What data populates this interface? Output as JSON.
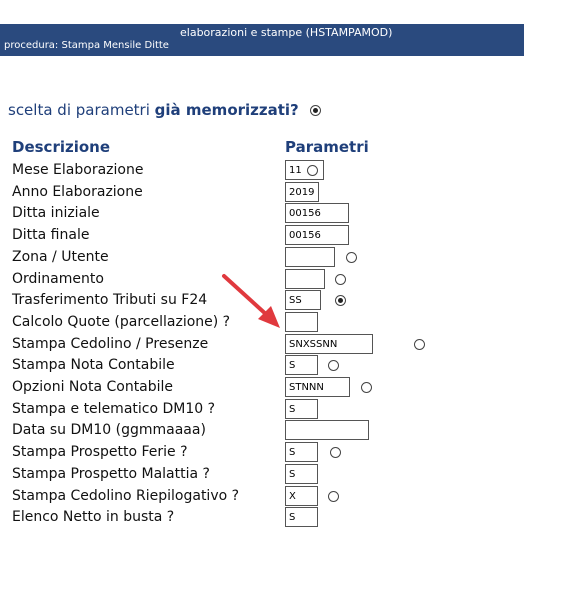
{
  "banner": {
    "line1": "elaborazioni e stampe    (HSTAMPAMOD)",
    "line2": "procedura:   Stampa Mensile Ditte"
  },
  "scelta": {
    "prefix": "scelta di parametri ",
    "bold": "già memorizzati?",
    "radio_checked": true
  },
  "headers": {
    "descrizione": "Descrizione",
    "parametri": "Parametri"
  },
  "rows": [
    {
      "label": "Mese Elaborazione",
      "value": "11",
      "radio": "unchecked"
    },
    {
      "label": "Anno Elaborazione",
      "value": "2019",
      "radio": "none"
    },
    {
      "label": "Ditta iniziale",
      "value": "00156",
      "radio": "none"
    },
    {
      "label": "Ditta finale",
      "value": "00156",
      "radio": "none"
    },
    {
      "label": "Zona / Utente",
      "value": "",
      "radio": "unchecked"
    },
    {
      "label": "Ordinamento",
      "value": "",
      "radio": "unchecked"
    },
    {
      "label": "Trasferimento Tributi su F24",
      "value": "SS",
      "radio": "checked"
    },
    {
      "label": "Calcolo Quote (parcellazione) ?",
      "value": "",
      "radio": "none"
    },
    {
      "label": "Stampa Cedolino / Presenze",
      "value": "SNXSSNN",
      "radio": "unchecked"
    },
    {
      "label": "Stampa Nota Contabile",
      "value": "S",
      "radio": "unchecked"
    },
    {
      "label": "Opzioni Nota Contabile",
      "value": "STNNN",
      "radio": "unchecked"
    },
    {
      "label": "Stampa e telematico DM10 ?",
      "value": "S",
      "radio": "none"
    },
    {
      "label": "Data su DM10 (ggmmaaaa)",
      "value": "",
      "radio": "none"
    },
    {
      "label": "Stampa Prospetto Ferie ?",
      "value": "S",
      "radio": "unchecked"
    },
    {
      "label": "Stampa Prospetto Malattia ?",
      "value": "S",
      "radio": "none"
    },
    {
      "label": "Stampa Cedolino Riepilogativo ?",
      "value": "X",
      "radio": "unchecked"
    },
    {
      "label": "Elenco Netto in busta ?",
      "value": "S",
      "radio": "none"
    }
  ],
  "colors": {
    "banner": "#2a4a7e",
    "heading": "#1f3f7a",
    "arrow": "#e0393e"
  }
}
